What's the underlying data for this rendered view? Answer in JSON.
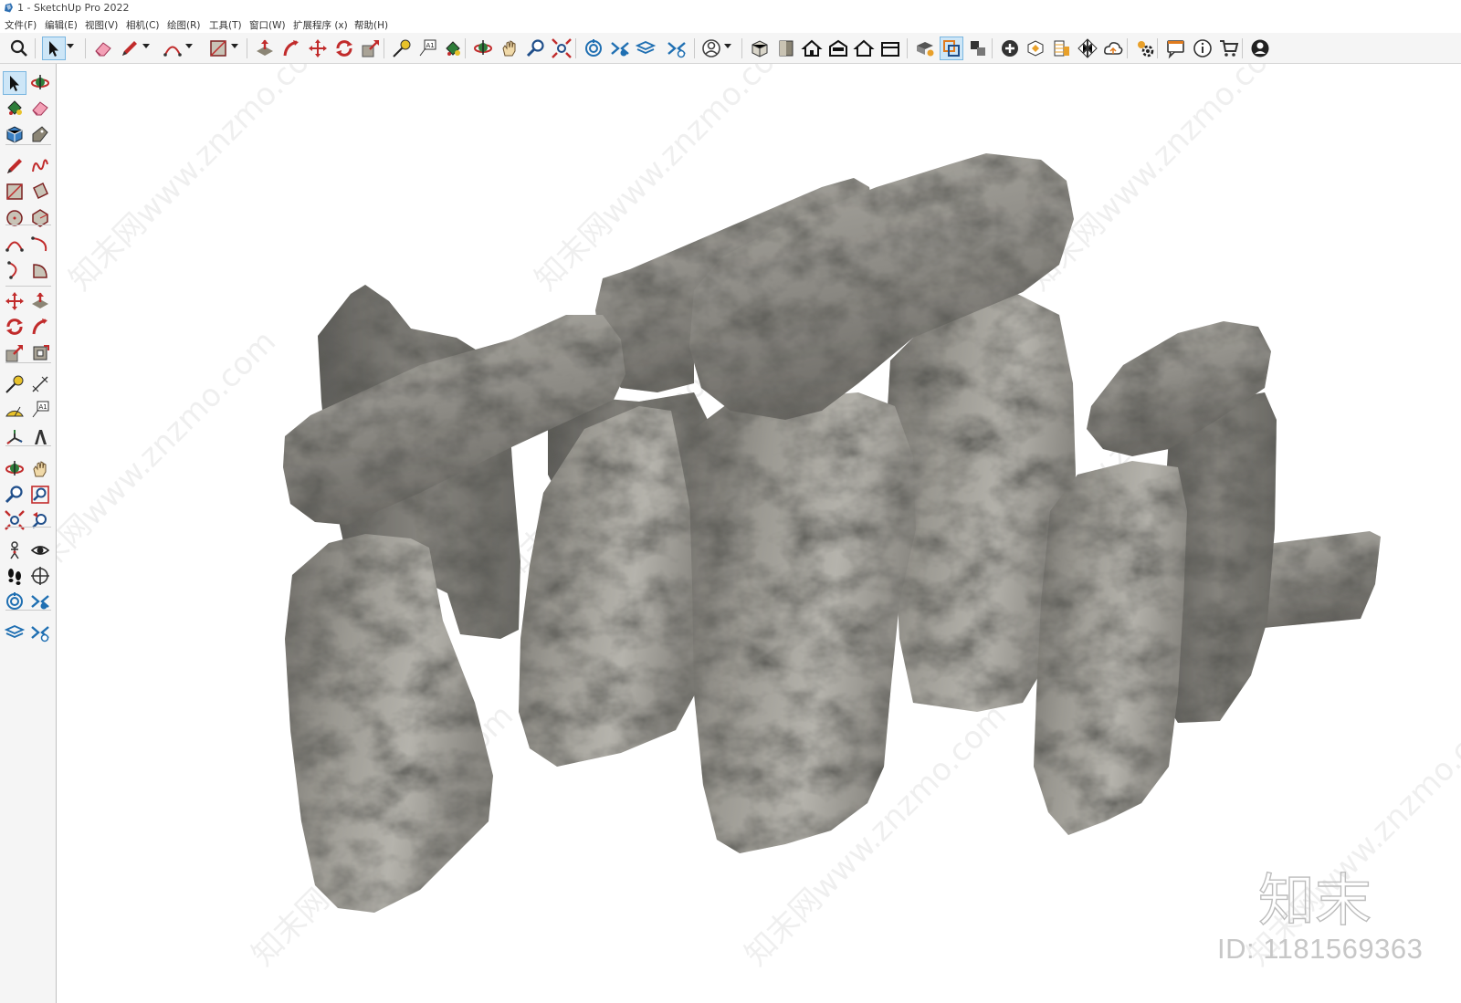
{
  "window": {
    "title": "1 - SketchUp Pro 2022",
    "icon": "sketchup-logo-icon"
  },
  "menu": [
    {
      "label": "文件(F)"
    },
    {
      "label": "编辑(E)"
    },
    {
      "label": "视图(V)"
    },
    {
      "label": "相机(C)"
    },
    {
      "label": "绘图(R)"
    },
    {
      "label": "工具(T)"
    },
    {
      "label": "窗口(W)"
    },
    {
      "label": "扩展程序 (x)"
    },
    {
      "label": "帮助(H)"
    }
  ],
  "toolbar": {
    "items": [
      {
        "icon": "search-icon",
        "active": false
      },
      {
        "icon": "select-arrow-icon",
        "active": true
      },
      {
        "icon": "eraser-icon",
        "active": false
      },
      {
        "icon": "pencil-line-icon",
        "active": false
      },
      {
        "icon": "arc-icon",
        "active": false
      },
      {
        "icon": "rectangle-icon",
        "active": false
      },
      {
        "icon": "push-pull-icon",
        "active": false
      },
      {
        "icon": "follow-me-icon",
        "active": false
      },
      {
        "icon": "move-icon",
        "active": false
      },
      {
        "icon": "rotate-icon",
        "active": false
      },
      {
        "icon": "scale-icon",
        "active": false
      },
      {
        "icon": "tape-measure-icon",
        "active": false
      },
      {
        "icon": "text-label-icon",
        "active": false
      },
      {
        "icon": "paint-bucket-icon",
        "active": false
      },
      {
        "icon": "orbit-icon",
        "active": false
      },
      {
        "icon": "pan-icon",
        "active": false
      },
      {
        "icon": "zoom-icon",
        "active": false
      },
      {
        "icon": "zoom-extents-icon",
        "active": false
      },
      {
        "icon": "warehouse-icon",
        "active": false
      },
      {
        "icon": "extension-warehouse-icon",
        "active": false
      },
      {
        "icon": "layout-icon",
        "active": false
      },
      {
        "icon": "extension-manager-icon",
        "active": false
      },
      {
        "icon": "user-account-icon",
        "active": false
      },
      {
        "icon": "iso-view-icon",
        "active": false
      },
      {
        "icon": "top-view-icon",
        "active": false
      },
      {
        "icon": "front-view-icon",
        "active": false
      },
      {
        "icon": "right-view-icon",
        "active": false
      },
      {
        "icon": "back-view-icon",
        "active": false
      },
      {
        "icon": "left-view-icon",
        "active": false
      },
      {
        "icon": "solid-tools-icon",
        "active": false
      },
      {
        "icon": "outer-shell-icon",
        "active": true
      },
      {
        "icon": "section-icon",
        "active": false
      },
      {
        "icon": "add-location-icon",
        "active": false
      },
      {
        "icon": "shadow-icon",
        "active": false
      },
      {
        "icon": "match-photo-icon",
        "active": false
      },
      {
        "icon": "checker-icon",
        "active": false
      },
      {
        "icon": "cloud-icon",
        "active": false
      },
      {
        "icon": "settings-icon",
        "active": false
      },
      {
        "icon": "message-icon",
        "active": false
      },
      {
        "icon": "info-icon",
        "active": false
      },
      {
        "icon": "cart-icon",
        "active": false
      },
      {
        "icon": "profile-icon",
        "active": false
      }
    ]
  },
  "sidebar": {
    "items": [
      {
        "icon": "select-arrow-icon",
        "active": true
      },
      {
        "icon": "orbit-icon",
        "active": false
      },
      {
        "icon": "paint-bucket-icon",
        "active": false
      },
      {
        "icon": "eraser-icon",
        "active": false
      },
      {
        "icon": "component-icon",
        "active": false
      },
      {
        "icon": "tag-icon",
        "active": false
      },
      {
        "icon": "pencil-line-icon",
        "active": false
      },
      {
        "icon": "freehand-icon",
        "active": false
      },
      {
        "icon": "rectangle-icon",
        "active": false
      },
      {
        "icon": "rotated-rectangle-icon",
        "active": false
      },
      {
        "icon": "circle-icon",
        "active": false
      },
      {
        "icon": "polygon-icon",
        "active": false
      },
      {
        "icon": "arc-icon",
        "active": false
      },
      {
        "icon": "two-point-arc-icon",
        "active": false
      },
      {
        "icon": "three-point-arc-icon",
        "active": false
      },
      {
        "icon": "pie-icon",
        "active": false
      },
      {
        "icon": "move-icon",
        "active": false
      },
      {
        "icon": "push-pull-icon",
        "active": false
      },
      {
        "icon": "rotate-icon",
        "active": false
      },
      {
        "icon": "follow-me-icon",
        "active": false
      },
      {
        "icon": "scale-icon",
        "active": false
      },
      {
        "icon": "offset-icon",
        "active": false
      },
      {
        "icon": "tape-measure-icon",
        "active": false
      },
      {
        "icon": "dimension-icon",
        "active": false
      },
      {
        "icon": "protractor-icon",
        "active": false
      },
      {
        "icon": "text-label-icon",
        "active": false
      },
      {
        "icon": "axes-icon",
        "active": false
      },
      {
        "icon": "3d-text-icon",
        "active": false
      },
      {
        "icon": "orbit-icon",
        "active": false
      },
      {
        "icon": "pan-icon",
        "active": false
      },
      {
        "icon": "zoom-icon",
        "active": false
      },
      {
        "icon": "zoom-window-icon",
        "active": false
      },
      {
        "icon": "zoom-extents-icon",
        "active": false
      },
      {
        "icon": "previous-view-icon",
        "active": false
      },
      {
        "icon": "position-camera-icon",
        "active": false
      },
      {
        "icon": "look-around-icon",
        "active": false
      },
      {
        "icon": "walk-icon",
        "active": false
      },
      {
        "icon": "section-plane-icon",
        "active": false
      },
      {
        "icon": "warehouse-icon",
        "active": false
      },
      {
        "icon": "extension-warehouse-icon",
        "active": false
      },
      {
        "icon": "layout-icon",
        "active": false
      },
      {
        "icon": "extension-manager-icon",
        "active": false
      }
    ]
  },
  "viewport": {
    "model": "stone-monument-model",
    "watermark": "www.znzmo.com",
    "brand_logo": "知末",
    "id_text": "ID: 1181569363"
  },
  "colors": {
    "stone_light": "#b9b7b0",
    "stone_mid": "#8f8d87",
    "stone_dark": "#5c5b57",
    "selection_blue": "#cde6f7"
  }
}
